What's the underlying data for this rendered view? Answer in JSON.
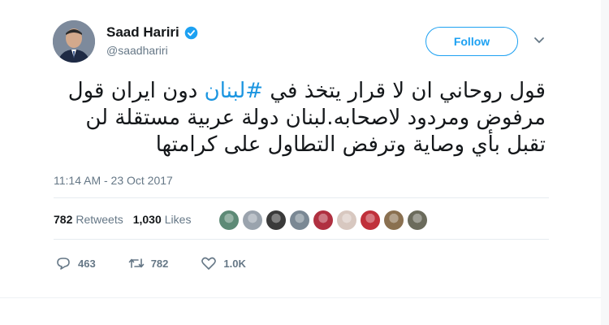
{
  "author": {
    "name": "Saad Hariri",
    "handle": "@saadhariri",
    "verified": true
  },
  "follow_button": {
    "label": "Follow"
  },
  "tweet": {
    "text_before": "قول روحاني ان لا قرار يتخذ في ",
    "hashtag": "#لبنان",
    "text_after": " دون  ايران قول مرفوض ومردود لاصحابه.لبنان دولة عربية مستقلة لن تقبل بأي وصاية وترفض التطاول على كرامتها",
    "timestamp": "11:14 AM - 23 Oct 2017"
  },
  "stats": {
    "retweets_count": "782",
    "retweets_label": "Retweets",
    "likes_count": "1,030",
    "likes_label": "Likes"
  },
  "liker_avatars": [
    "#5d8a76",
    "#9aa3ad",
    "#3a3a3a",
    "#7a8894",
    "#b03040",
    "#d8c8c0",
    "#c0303a",
    "#8a7050",
    "#6b6b5c"
  ],
  "actions": {
    "reply_count": "463",
    "retweet_count": "782",
    "like_count": "1.0K"
  },
  "colors": {
    "accent": "#1da1f2",
    "hashtag": "#1b95e0",
    "muted": "#657786"
  }
}
